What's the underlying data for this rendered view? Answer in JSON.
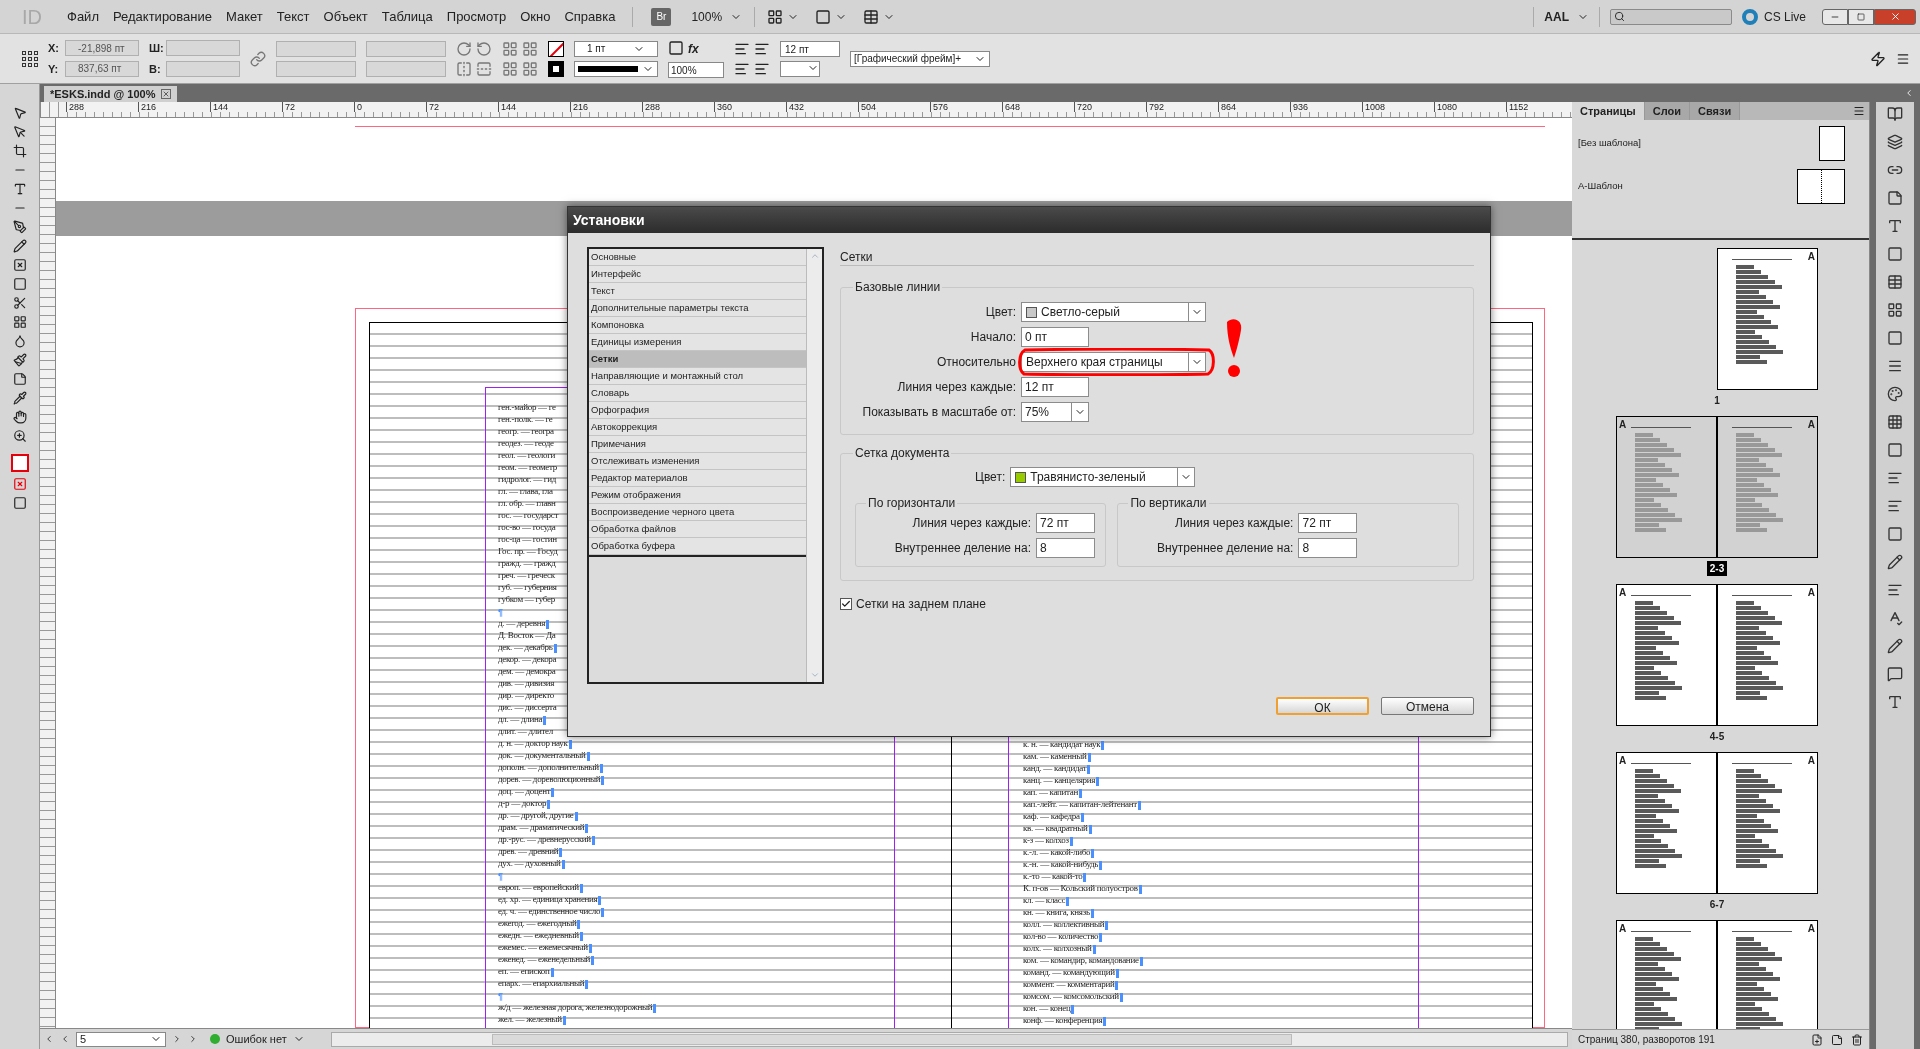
{
  "app_bar": {
    "logo": "ID",
    "menu": [
      "Файл",
      "Редактирование",
      "Макет",
      "Текст",
      "Объект",
      "Таблица",
      "Просмотр",
      "Окно",
      "Справка"
    ],
    "bridge": "Br",
    "zoom": "100%",
    "workspace": "AAL",
    "cs_live": "CS Live"
  },
  "control_panel": {
    "x_label": "X:",
    "x": "-21,898 пт",
    "y_label": "Y:",
    "y": "837,63 пт",
    "w_label": "Ш:",
    "h_label": "В:",
    "stroke_weight": "1 пт",
    "opacity": "100%",
    "size": "12 пт",
    "effects_label": "fx",
    "object_style": "[Графический фрейм]+"
  },
  "document_tab": {
    "title": "*ESKS.indd @ 100%"
  },
  "ruler": [
    "288",
    "216",
    "144",
    "72",
    "0",
    "72",
    "144",
    "216",
    "288",
    "360",
    "432",
    "504",
    "576",
    "648",
    "720",
    "792",
    "864",
    "936",
    "1008",
    "1080",
    "1152"
  ],
  "document": {
    "left_column": [
      {
        "kind": "entry",
        "text": "ген.-майор — ге",
        "end_mark": false
      },
      {
        "kind": "entry",
        "text": "ген.-полк. — ге",
        "end_mark": false
      },
      {
        "kind": "entry",
        "text": "геогр. — геогра",
        "end_mark": false
      },
      {
        "kind": "entry",
        "text": "геодез. — геоде",
        "end_mark": false
      },
      {
        "kind": "entry",
        "text": "геол. — геологи",
        "end_mark": false
      },
      {
        "kind": "entry",
        "text": "геом. — геометр",
        "end_mark": false
      },
      {
        "kind": "entry",
        "text": "гидролог. — гид",
        "end_mark": false
      },
      {
        "kind": "entry",
        "text": "гл. — глава, гла",
        "end_mark": false
      },
      {
        "kind": "entry",
        "text": "гл. обр. — главн",
        "end_mark": false
      },
      {
        "kind": "entry",
        "text": "гос. — государст",
        "end_mark": false
      },
      {
        "kind": "entry",
        "text": "гос-во — госуда",
        "end_mark": false
      },
      {
        "kind": "entry",
        "text": "гос-ца — гостин",
        "end_mark": false
      },
      {
        "kind": "entry",
        "text": "Гос. пр. — Госуд",
        "end_mark": false
      },
      {
        "kind": "entry",
        "text": "гражд. — гражд",
        "end_mark": false
      },
      {
        "kind": "entry",
        "text": "греч. — греческ",
        "end_mark": false
      },
      {
        "kind": "entry",
        "text": "губ. — губерния",
        "end_mark": false
      },
      {
        "kind": "entry",
        "text": "губком — губер",
        "end_mark": false
      },
      {
        "kind": "break",
        "text": "¶"
      },
      {
        "kind": "entry",
        "text": "д. — деревня",
        "end_mark": true
      },
      {
        "kind": "entry",
        "text": "Д. Восток — Да",
        "end_mark": false
      },
      {
        "kind": "entry",
        "text": "дек. — декабрь",
        "end_mark": true
      },
      {
        "kind": "entry",
        "text": "декор. — декора",
        "end_mark": false
      },
      {
        "kind": "entry",
        "text": "дем. — демокра",
        "end_mark": false
      },
      {
        "kind": "entry",
        "text": "див. — дивизия",
        "end_mark": false
      },
      {
        "kind": "entry",
        "text": "дир. — директо",
        "end_mark": false
      },
      {
        "kind": "entry",
        "text": "дис. — диссерта",
        "end_mark": false
      },
      {
        "kind": "entry",
        "text": "дл. — длина",
        "end_mark": true
      },
      {
        "kind": "entry",
        "text": "длит. — длител",
        "end_mark": false
      },
      {
        "kind": "entry",
        "text": "д. н. — доктор наук",
        "end_mark": true
      },
      {
        "kind": "entry",
        "text": "док. — документальный",
        "end_mark": true
      },
      {
        "kind": "entry",
        "text": "дополн. — дополнительный",
        "end_mark": true
      },
      {
        "kind": "entry",
        "text": "дорев. — дореволюционный",
        "end_mark": true
      },
      {
        "kind": "entry",
        "text": "доц. — доцент",
        "end_mark": true
      },
      {
        "kind": "entry",
        "text": "д-р — доктор",
        "end_mark": true
      },
      {
        "kind": "entry",
        "text": "др. — другой, другие",
        "end_mark": true
      },
      {
        "kind": "entry",
        "text": "драм. — драматический",
        "end_mark": true
      },
      {
        "kind": "entry",
        "text": "др.-рус. — древнерусский",
        "end_mark": true
      },
      {
        "kind": "entry",
        "text": "древ. — древний",
        "end_mark": true
      },
      {
        "kind": "entry",
        "text": "дух. — духовный",
        "end_mark": true
      },
      {
        "kind": "break",
        "text": "¶"
      },
      {
        "kind": "entry",
        "text": "европ. — европейский",
        "end_mark": true
      },
      {
        "kind": "entry",
        "text": "ед. хр. — единица хранения",
        "end_mark": true
      },
      {
        "kind": "entry",
        "text": "ед. ч. — единственное число",
        "end_mark": true
      },
      {
        "kind": "entry",
        "text": "ежегод. — ежегодный",
        "end_mark": true
      },
      {
        "kind": "entry",
        "text": "ежедн. — ежедневный",
        "end_mark": true
      },
      {
        "kind": "entry",
        "text": "ежемес. — ежемесячный",
        "end_mark": true
      },
      {
        "kind": "entry",
        "text": "еженед. — еженедельный",
        "end_mark": true
      },
      {
        "kind": "entry",
        "text": "еп. — епископ",
        "end_mark": true
      },
      {
        "kind": "entry",
        "text": "епарх. — епархиальный",
        "end_mark": true
      },
      {
        "kind": "break",
        "text": "¶"
      },
      {
        "kind": "entry",
        "text": "ж/д — железная дорога, железнодорожный",
        "end_mark": true
      },
      {
        "kind": "entry",
        "text": "жел. — железный",
        "end_mark": true
      }
    ],
    "right_column": [
      {
        "kind": "entry",
        "text": "к. н. — кандидат наук",
        "end_mark": true
      },
      {
        "kind": "entry",
        "text": "кам. — каменный",
        "end_mark": true
      },
      {
        "kind": "entry",
        "text": "канд. — кандидат",
        "end_mark": true
      },
      {
        "kind": "entry",
        "text": "канц. — канцелярия",
        "end_mark": true
      },
      {
        "kind": "entry",
        "text": "кап. — капитан",
        "end_mark": true
      },
      {
        "kind": "entry",
        "text": "кап.-лейт. — капитан-лейтенант",
        "end_mark": true
      },
      {
        "kind": "entry",
        "text": "каф. — кафедра",
        "end_mark": true
      },
      {
        "kind": "entry",
        "text": "кв. — квадратный",
        "end_mark": true
      },
      {
        "kind": "entry",
        "text": "к-з — колхоз",
        "end_mark": true
      },
      {
        "kind": "entry",
        "text": "к.-л. — какой-либо",
        "end_mark": true
      },
      {
        "kind": "entry",
        "text": "к.-н. — какой-нибудь",
        "end_mark": true
      },
      {
        "kind": "entry",
        "text": "к.-то — какой-то",
        "end_mark": true
      },
      {
        "kind": "entry",
        "text": "К. п-ов — Кольский полуостров",
        "end_mark": true
      },
      {
        "kind": "entry",
        "text": "кл. — класс",
        "end_mark": true
      },
      {
        "kind": "entry",
        "text": "кн. — книга, князь",
        "end_mark": true
      },
      {
        "kind": "entry",
        "text": "колл. — коллективный",
        "end_mark": true
      },
      {
        "kind": "entry",
        "text": "кол-во — количество",
        "end_mark": true
      },
      {
        "kind": "entry",
        "text": "колх. — колхозный",
        "end_mark": true
      },
      {
        "kind": "entry",
        "text": "ком. — командир, командование",
        "end_mark": true
      },
      {
        "kind": "entry",
        "text": "команд. — командующий",
        "end_mark": true
      },
      {
        "kind": "entry",
        "text": "коммент. — комментарий",
        "end_mark": true
      },
      {
        "kind": "entry",
        "text": "комсом. — комсомольский",
        "end_mark": true
      },
      {
        "kind": "entry",
        "text": "кон. — конец",
        "end_mark": true
      },
      {
        "kind": "entry",
        "text": "конф. — конференция",
        "end_mark": true
      }
    ]
  },
  "dialog": {
    "title": "Установки",
    "categories": [
      {
        "label": "Основные",
        "selected": false
      },
      {
        "label": "Интерфейс",
        "selected": false
      },
      {
        "label": "Текст",
        "selected": false
      },
      {
        "label": "Дополнительные параметры текста",
        "selected": false
      },
      {
        "label": "Компоновка",
        "selected": false
      },
      {
        "label": "Единицы измерения",
        "selected": false
      },
      {
        "label": "Сетки",
        "selected": true
      },
      {
        "label": "Направляющие и монтажный стол",
        "selected": false
      },
      {
        "label": "Словарь",
        "selected": false
      },
      {
        "label": "Орфография",
        "selected": false
      },
      {
        "label": "Автокоррекция",
        "selected": false
      },
      {
        "label": "Примечания",
        "selected": false
      },
      {
        "label": "Отслеживать изменения",
        "selected": false
      },
      {
        "label": "Редактор материалов",
        "selected": false
      },
      {
        "label": "Режим отображения",
        "selected": false
      },
      {
        "label": "Воспроизведение черного цвета",
        "selected": false
      },
      {
        "label": "Обработка файлов",
        "selected": false
      },
      {
        "label": "Обработка буфера",
        "selected": false
      }
    ],
    "heading": "Сетки",
    "baseline": {
      "legend": "Базовые линии",
      "rows": [
        {
          "kind": "color",
          "label": "Цвет:",
          "value": "Светло-серый",
          "color": "#c8c8c8"
        },
        {
          "kind": "field",
          "label": "Начало:",
          "value": "0 пт"
        },
        {
          "kind": "select",
          "label": "Относительно",
          "value": "Верхнего края страницы",
          "annotated": true
        },
        {
          "kind": "field",
          "label": "Линия через каждые:",
          "value": "12 пт"
        },
        {
          "kind": "combo",
          "label": "Показывать в масштабе от:",
          "value": "75%"
        }
      ]
    },
    "document_grid": {
      "legend": "Сетка документа",
      "color_label": "Цвет:",
      "color_value": "Травянисто-зеленый",
      "color": "#99cc00",
      "groups": [
        {
          "legend": "По горизонтали",
          "rows": [
            {
              "label": "Линия через каждые:",
              "value": "72 пт"
            },
            {
              "label": "Внутреннее деление на:",
              "value": "8"
            }
          ]
        },
        {
          "legend": "По вертикали",
          "rows": [
            {
              "label": "Линия через каждые:",
              "value": "72 пт"
            },
            {
              "label": "Внутреннее деление на:",
              "value": "8"
            }
          ]
        }
      ]
    },
    "background_option": {
      "label": "Сетки на заднем плане",
      "checked": true
    },
    "buttons": [
      {
        "label": "ОК",
        "default": true
      },
      {
        "label": "Отмена",
        "default": false
      }
    ]
  },
  "pages_panel": {
    "tabs": [
      {
        "label": "Страницы",
        "selected": true
      },
      {
        "label": "Слои",
        "selected": false
      },
      {
        "label": "Связи",
        "selected": false
      }
    ],
    "masters": [
      {
        "label": "[Без шаблона]",
        "kind": "single"
      },
      {
        "label": "А-Шаблон",
        "kind": "spread"
      }
    ],
    "spreads": [
      {
        "label": "1",
        "kind": "single",
        "pages": [
          "A"
        ],
        "selected": false
      },
      {
        "label": "2-3",
        "pages": [
          "A",
          "A"
        ],
        "selected": true
      },
      {
        "label": "4-5",
        "pages": [
          "A",
          "A"
        ],
        "selected": false
      },
      {
        "label": "6-7",
        "pages": [
          "A",
          "A"
        ],
        "selected": false
      },
      {
        "pages": [
          "A",
          "A"
        ],
        "selected": false
      }
    ],
    "footer": "Страниц 380, разворотов 191"
  },
  "status_bar": {
    "page": "5",
    "preflight": "Ошибок нет"
  }
}
